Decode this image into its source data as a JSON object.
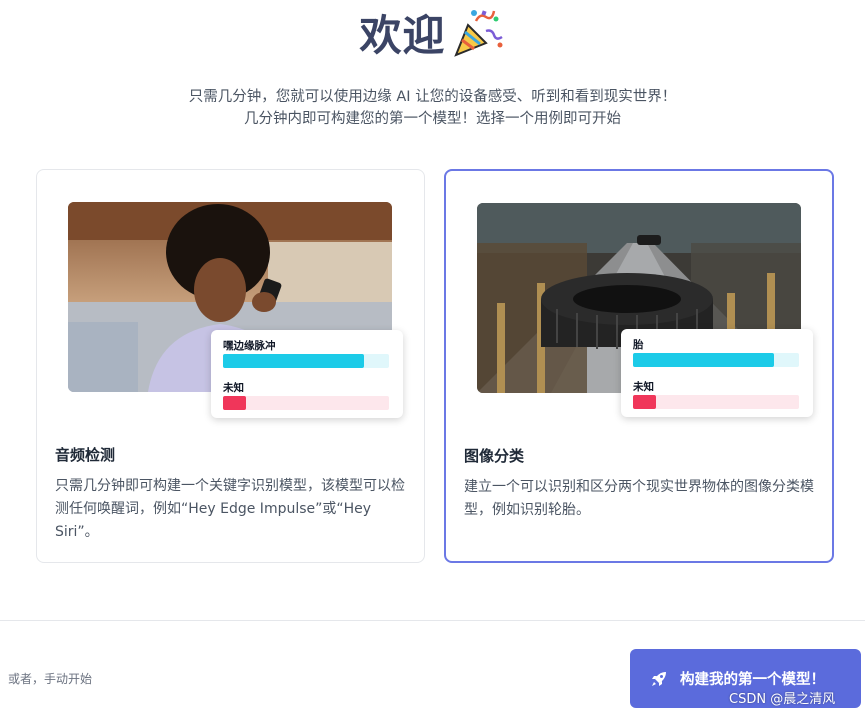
{
  "header": {
    "title": "欢迎",
    "subtitle_line1": "只需几分钟，您就可以使用边缘 AI 让您的设备感受、听到和看到现实世界！",
    "subtitle_line2": "几分钟内即可构建您的第一个模型！选择一个用例即可开始"
  },
  "cards": [
    {
      "title": "音频检测",
      "description": "只需几分钟即可构建一个关键字识别模型，该模型可以检测任何唤醒词，例如“Hey Edge Impulse”或“Hey Siri”。",
      "image": "person-speaking-into-phone",
      "predictions": [
        {
          "label": "嘿边缘脉冲",
          "value": 0.85,
          "color": "#1ccbe8",
          "track": "#e0f7fb"
        },
        {
          "label": "未知",
          "value": 0.14,
          "color": "#f0365a",
          "track": "#fde7ec"
        }
      ]
    },
    {
      "title": "图像分类",
      "description": "建立一个可以识别和区分两个现实世界物体的图像分类模型，例如识别轮胎。",
      "image": "tire-on-factory-conveyor",
      "predictions": [
        {
          "label": "胎",
          "value": 0.85,
          "color": "#1ccbe8",
          "track": "#e0f7fb"
        },
        {
          "label": "未知",
          "value": 0.14,
          "color": "#f0365a",
          "track": "#fde7ec"
        }
      ]
    }
  ],
  "footer": {
    "manual_link": "或者，手动开始",
    "cta_label": "构建我的第一个模型！",
    "cta_icon": "rocket-icon",
    "watermark": "CSDN @晨之清风"
  },
  "colors": {
    "accent": "#5b6bdc",
    "selected_border": "#6b78e5",
    "title": "#3b4465"
  }
}
